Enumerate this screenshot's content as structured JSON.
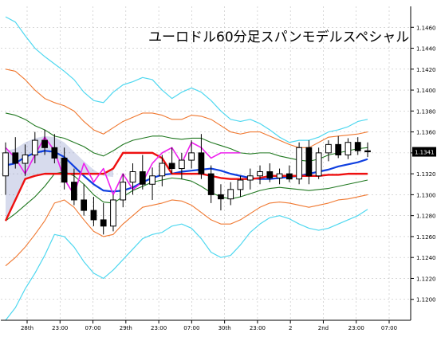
{
  "chart_data": {
    "type": "candlestick",
    "title": "ユーロドル60分足スパンモデルスペシャル",
    "ylim": [
      1.118,
      1.148
    ],
    "y_ticks": [
      "1.1460",
      "1.1440",
      "1.1420",
      "1.1400",
      "1.1380",
      "1.1360",
      "1.1340",
      "1.1320",
      "1.1300",
      "1.1280",
      "1.1260",
      "1.1240",
      "1.1220",
      "1.1200"
    ],
    "x_labels": [
      "28th",
      "23:00",
      "07:00",
      "29th",
      "23:00",
      "07:00",
      "30th",
      "23:00",
      "2",
      "2nd",
      "23:00",
      "07:00"
    ],
    "current_price": "1.1341",
    "grid": true,
    "colors": {
      "background": "#ffffff",
      "grid": "#c0c0c0",
      "axis": "#000000",
      "bull": "#ffffff",
      "bear": "#000000",
      "wick": "#000000",
      "bb_outer": "#4fd8f0",
      "bb_mid": "#f07830",
      "bb_inner": "#207820",
      "ma": "#1040e0",
      "span": "#ee1010",
      "chikou": "#ee20ee",
      "cloud": "#1f3a9c",
      "price_box": "#000000",
      "price_text": "#ffffff"
    },
    "series": [
      {
        "key": "bb_outer_up",
        "values": [
          1.147,
          1.1465,
          1.1452,
          1.144,
          1.1432,
          1.1425,
          1.1418,
          1.141,
          1.1398,
          1.139,
          1.1388,
          1.1398,
          1.1405,
          1.1408,
          1.1412,
          1.141,
          1.14,
          1.1392,
          1.1398,
          1.1402,
          1.1398,
          1.139,
          1.138,
          1.1372,
          1.137,
          1.1372,
          1.1368,
          1.1362,
          1.1355,
          1.135,
          1.1352,
          1.1352,
          1.1355,
          1.136,
          1.1362,
          1.1365,
          1.137,
          1.1372
        ]
      },
      {
        "key": "bb_outer_dn",
        "values": [
          1.118,
          1.1192,
          1.121,
          1.1225,
          1.1242,
          1.1262,
          1.126,
          1.125,
          1.1236,
          1.1225,
          1.122,
          1.1228,
          1.1238,
          1.1248,
          1.1258,
          1.1262,
          1.1264,
          1.127,
          1.1272,
          1.1268,
          1.1258,
          1.1245,
          1.124,
          1.1242,
          1.1252,
          1.1264,
          1.1272,
          1.1278,
          1.128,
          1.1277,
          1.1272,
          1.1268,
          1.1266,
          1.1268,
          1.1272,
          1.1276,
          1.128,
          1.1286
        ]
      },
      {
        "key": "bb_mid_up",
        "values": [
          1.142,
          1.1418,
          1.141,
          1.14,
          1.1392,
          1.1388,
          1.1385,
          1.138,
          1.137,
          1.1362,
          1.1358,
          1.1364,
          1.137,
          1.1374,
          1.1378,
          1.1378,
          1.1376,
          1.1372,
          1.1372,
          1.1376,
          1.1375,
          1.1372,
          1.1366,
          1.136,
          1.1358,
          1.136,
          1.136,
          1.1356,
          1.1352,
          1.1348,
          1.1345,
          1.1345,
          1.135,
          1.1355,
          1.1356,
          1.1357,
          1.1358,
          1.136
        ]
      },
      {
        "key": "bb_mid_dn",
        "values": [
          1.1232,
          1.124,
          1.125,
          1.1262,
          1.1275,
          1.1292,
          1.1295,
          1.1288,
          1.1276,
          1.1265,
          1.126,
          1.1262,
          1.1272,
          1.128,
          1.1288,
          1.129,
          1.1292,
          1.1295,
          1.1294,
          1.129,
          1.1283,
          1.1276,
          1.1272,
          1.1272,
          1.1276,
          1.1282,
          1.1288,
          1.1292,
          1.1293,
          1.1292,
          1.129,
          1.1288,
          1.129,
          1.1292,
          1.1295,
          1.1296,
          1.1298,
          1.13
        ]
      },
      {
        "key": "bb_inner_up",
        "values": [
          1.1378,
          1.1376,
          1.1372,
          1.1366,
          1.1362,
          1.1356,
          1.1354,
          1.135,
          1.1346,
          1.134,
          1.1337,
          1.1342,
          1.1348,
          1.1352,
          1.1354,
          1.1356,
          1.1356,
          1.1354,
          1.1353,
          1.1354,
          1.1354,
          1.135,
          1.1347,
          1.1344,
          1.134,
          1.1339,
          1.134,
          1.134,
          1.1337,
          1.1335,
          1.1333,
          1.1332,
          1.1334,
          1.1338,
          1.134,
          1.1342,
          1.1344,
          1.1345
        ]
      },
      {
        "key": "bb_inner_dn",
        "values": [
          1.1275,
          1.1282,
          1.129,
          1.1298,
          1.1308,
          1.132,
          1.1322,
          1.1318,
          1.131,
          1.13,
          1.1293,
          1.1292,
          1.1298,
          1.1304,
          1.1308,
          1.1312,
          1.1314,
          1.1316,
          1.1315,
          1.1313,
          1.1308,
          1.1302,
          1.1298,
          1.1296,
          1.1298,
          1.1301,
          1.1304,
          1.1306,
          1.1307,
          1.1306,
          1.1305,
          1.1304,
          1.1305,
          1.1306,
          1.1308,
          1.131,
          1.1312,
          1.1314
        ]
      },
      {
        "key": "ma",
        "values": [
          1.1328,
          1.133,
          1.1336,
          1.134,
          1.1342,
          1.1341,
          1.1336,
          1.1327,
          1.1318,
          1.131,
          1.1304,
          1.1303,
          1.1304,
          1.1307,
          1.1312,
          1.1316,
          1.1319,
          1.132,
          1.1322,
          1.1323,
          1.1324,
          1.1325,
          1.1323,
          1.132,
          1.1318,
          1.1316,
          1.1315,
          1.1315,
          1.1316,
          1.1317,
          1.1318,
          1.132,
          1.1322,
          1.1324,
          1.1327,
          1.1329,
          1.1331,
          1.1334
        ]
      },
      {
        "key": "span",
        "values": [
          1.1275,
          1.1295,
          1.1315,
          1.1318,
          1.132,
          1.132,
          1.132,
          1.132,
          1.132,
          1.132,
          1.132,
          1.1325,
          1.134,
          1.134,
          1.134,
          1.134,
          1.1335,
          1.132,
          1.132,
          1.132,
          1.132,
          1.1318,
          1.1316,
          1.1315,
          1.1315,
          1.1315,
          1.1316,
          1.1318,
          1.1318,
          1.1318,
          1.1318,
          1.1318,
          1.1318,
          1.1319,
          1.1319,
          1.132,
          1.132,
          1.132
        ]
      },
      {
        "key": "chikou",
        "values": [
          1.1345,
          1.1335,
          1.132,
          1.1338,
          1.1355,
          1.1342,
          1.1315,
          1.13,
          1.133,
          1.1312,
          1.1325,
          1.13,
          1.132,
          1.1305,
          1.1312,
          1.133,
          1.134,
          1.1345,
          1.133,
          1.135,
          1.1345,
          1.1335,
          1.134,
          1.134,
          1.134
        ]
      }
    ],
    "candles": [
      {
        "o": 1.1318,
        "h": 1.135,
        "l": 1.13,
        "c": 1.134
      },
      {
        "o": 1.134,
        "h": 1.1355,
        "l": 1.1325,
        "c": 1.133
      },
      {
        "o": 1.133,
        "h": 1.1348,
        "l": 1.1318,
        "c": 1.1338
      },
      {
        "o": 1.1338,
        "h": 1.136,
        "l": 1.133,
        "c": 1.1352
      },
      {
        "o": 1.1352,
        "h": 1.1362,
        "l": 1.1338,
        "c": 1.1345
      },
      {
        "o": 1.1345,
        "h": 1.1358,
        "l": 1.133,
        "c": 1.1335
      },
      {
        "o": 1.1335,
        "h": 1.1345,
        "l": 1.1305,
        "c": 1.1312
      },
      {
        "o": 1.1312,
        "h": 1.1325,
        "l": 1.129,
        "c": 1.1295
      },
      {
        "o": 1.1295,
        "h": 1.131,
        "l": 1.128,
        "c": 1.1285
      },
      {
        "o": 1.1285,
        "h": 1.1298,
        "l": 1.127,
        "c": 1.1276
      },
      {
        "o": 1.1276,
        "h": 1.1292,
        "l": 1.1262,
        "c": 1.127
      },
      {
        "o": 1.127,
        "h": 1.13,
        "l": 1.1265,
        "c": 1.1295
      },
      {
        "o": 1.1295,
        "h": 1.132,
        "l": 1.1288,
        "c": 1.1312
      },
      {
        "o": 1.1312,
        "h": 1.133,
        "l": 1.13,
        "c": 1.1322
      },
      {
        "o": 1.1322,
        "h": 1.1338,
        "l": 1.1305,
        "c": 1.131
      },
      {
        "o": 1.131,
        "h": 1.1326,
        "l": 1.1295,
        "c": 1.1318
      },
      {
        "o": 1.1318,
        "h": 1.1338,
        "l": 1.1308,
        "c": 1.133
      },
      {
        "o": 1.133,
        "h": 1.1345,
        "l": 1.132,
        "c": 1.1325
      },
      {
        "o": 1.1325,
        "h": 1.134,
        "l": 1.1315,
        "c": 1.1333
      },
      {
        "o": 1.1333,
        "h": 1.1352,
        "l": 1.1325,
        "c": 1.134
      },
      {
        "o": 1.134,
        "h": 1.1358,
        "l": 1.1315,
        "c": 1.132
      },
      {
        "o": 1.132,
        "h": 1.1328,
        "l": 1.1292,
        "c": 1.13
      },
      {
        "o": 1.13,
        "h": 1.131,
        "l": 1.1285,
        "c": 1.1296
      },
      {
        "o": 1.1296,
        "h": 1.1312,
        "l": 1.129,
        "c": 1.1305
      },
      {
        "o": 1.1305,
        "h": 1.1318,
        "l": 1.1298,
        "c": 1.1314
      },
      {
        "o": 1.1314,
        "h": 1.1325,
        "l": 1.1305,
        "c": 1.1318
      },
      {
        "o": 1.1318,
        "h": 1.1328,
        "l": 1.131,
        "c": 1.1322
      },
      {
        "o": 1.1322,
        "h": 1.133,
        "l": 1.1312,
        "c": 1.1316
      },
      {
        "o": 1.1316,
        "h": 1.1325,
        "l": 1.131,
        "c": 1.132
      },
      {
        "o": 1.132,
        "h": 1.1328,
        "l": 1.1312,
        "c": 1.1315
      },
      {
        "o": 1.1315,
        "h": 1.135,
        "l": 1.131,
        "c": 1.1345
      },
      {
        "o": 1.1345,
        "h": 1.1352,
        "l": 1.131,
        "c": 1.1318
      },
      {
        "o": 1.1318,
        "h": 1.1345,
        "l": 1.1315,
        "c": 1.134
      },
      {
        "o": 1.134,
        "h": 1.1352,
        "l": 1.1332,
        "c": 1.1348
      },
      {
        "o": 1.1348,
        "h": 1.1356,
        "l": 1.1335,
        "c": 1.1338
      },
      {
        "o": 1.1338,
        "h": 1.1354,
        "l": 1.1334,
        "c": 1.135
      },
      {
        "o": 1.135,
        "h": 1.1355,
        "l": 1.1338,
        "c": 1.1342
      },
      {
        "o": 1.1342,
        "h": 1.135,
        "l": 1.1336,
        "c": 1.1341
      }
    ]
  }
}
